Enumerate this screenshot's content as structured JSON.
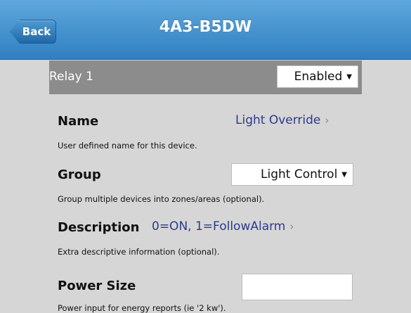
{
  "nav": {
    "back_label": "Back",
    "title": "4A3-B5DW"
  },
  "relay": {
    "label": "Relay 1",
    "status": "Enabled"
  },
  "fields": {
    "name": {
      "title": "Name",
      "value": "Light Override",
      "description": "User defined name for this device."
    },
    "group": {
      "title": "Group",
      "value": "Light Control",
      "description": "Group multiple devices into zones/areas (optional)."
    },
    "description": {
      "title": "Description",
      "value": "0=ON, 1=FollowAlarm",
      "description": "Extra descriptive information (optional)."
    },
    "power_size": {
      "title": "Power Size",
      "value": "",
      "description": "Power input for energy reports (ie '2 kw')."
    }
  },
  "icons": {
    "chevron": "chevron-right-icon",
    "caret": "caret-down-icon"
  }
}
